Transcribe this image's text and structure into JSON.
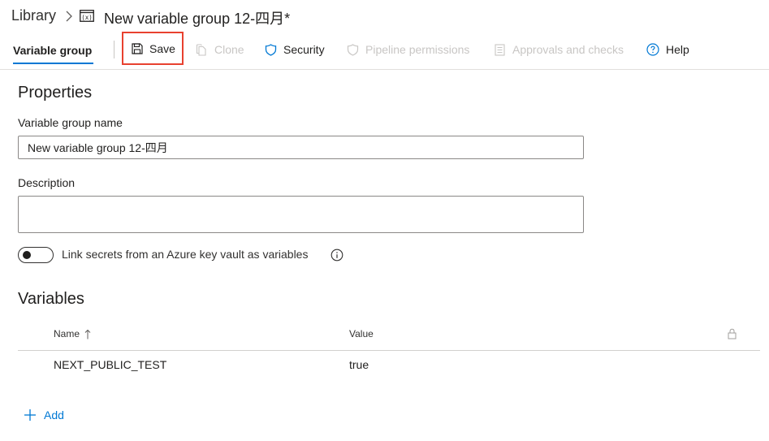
{
  "breadcrumb": {
    "root": "Library",
    "title": "New variable group 12-四月*"
  },
  "toolbar": {
    "active_tab": "Variable group",
    "save": "Save",
    "clone": "Clone",
    "security": "Security",
    "pipeline_permissions": "Pipeline permissions",
    "approvals": "Approvals and checks",
    "help": "Help"
  },
  "properties": {
    "heading": "Properties",
    "name_label": "Variable group name",
    "name_value": "New variable group 12-四月",
    "description_label": "Description",
    "description_value": "",
    "link_secrets_label": "Link secrets from an Azure key vault as variables",
    "link_secrets_enabled": false
  },
  "variables": {
    "heading": "Variables",
    "columns": {
      "name": "Name",
      "value": "Value"
    },
    "rows": [
      {
        "name": "NEXT_PUBLIC_TEST",
        "value": "true"
      }
    ],
    "add_label": "Add"
  },
  "colors": {
    "accent": "#0078d4",
    "highlight_border": "#e8412f",
    "disabled_text": "#c8c6c4"
  }
}
